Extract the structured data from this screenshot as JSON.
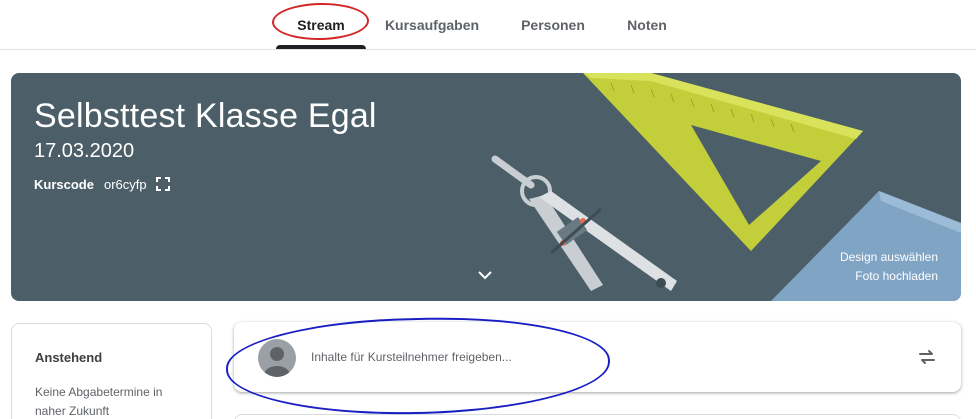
{
  "nav": {
    "tabs": [
      {
        "label": "Stream",
        "active": true
      },
      {
        "label": "Kursaufgaben",
        "active": false
      },
      {
        "label": "Personen",
        "active": false
      },
      {
        "label": "Noten",
        "active": false
      }
    ]
  },
  "banner": {
    "title": "Selbsttest Klasse Egal",
    "subtitle": "17.03.2020",
    "code_label": "Kurscode",
    "code_value": "or6cyfp",
    "design_link": "Design auswählen",
    "photo_link": "Foto hochladen",
    "background_color": "#4c5f68",
    "icons": {
      "expand": "fullscreen-icon",
      "chevron": "chevron-down-icon"
    }
  },
  "upcoming": {
    "title": "Anstehend",
    "empty_text": "Keine Abgabetermine in naher Zukunft"
  },
  "share": {
    "placeholder": "Inhalte für Kursteilnehmer freigeben...",
    "icons": {
      "avatar": "avatar-icon",
      "repost": "repost-icon"
    }
  },
  "annotations": {
    "red_ring_color": "#d32626",
    "blue_ring_color": "#1a1fc4"
  }
}
